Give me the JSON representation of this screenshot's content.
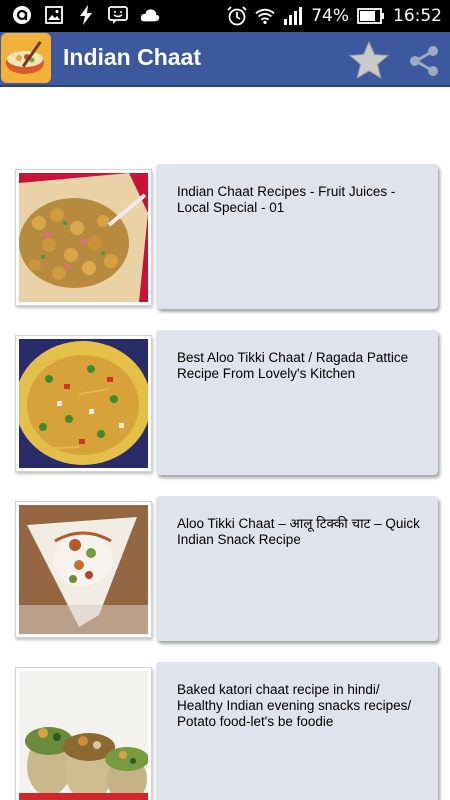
{
  "status_bar": {
    "battery_percent": "74%",
    "time": "16:52",
    "left_icons": [
      "notification-a-icon",
      "image-icon",
      "flash-icon",
      "chat-icon",
      "cloud-icon"
    ],
    "right_icons": [
      "alarm-icon",
      "wifi-icon",
      "signal-icon",
      "battery-icon"
    ]
  },
  "app_bar": {
    "title": "Indian Chaat",
    "background": "#3e58a0",
    "actions": [
      "star-icon",
      "share-icon"
    ]
  },
  "videos": [
    {
      "title": "Indian Chaat Recipes - Fruit Juices - Local Special - 01"
    },
    {
      "title": "Best Aloo Tikki Chaat / Ragada Pattice Recipe From Lovely's Kitchen"
    },
    {
      "title": "Aloo Tikki Chaat –  आलू टिक्की चाट – Quick Indian Snack Recipe"
    },
    {
      "title": "Baked katori chaat recipe in hindi/ Healthy Indian evening snacks recipes/ Potato food-let's be foodie"
    }
  ]
}
